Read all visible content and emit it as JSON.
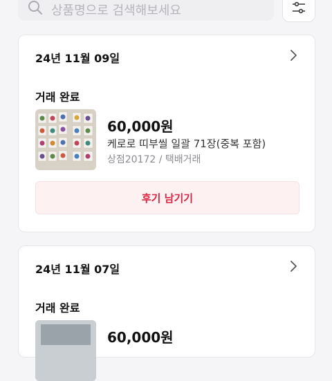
{
  "search": {
    "placeholder": "상품명으로 검색해보세요",
    "icon": "search-icon"
  },
  "filter": {
    "icon": "filter-sliders-icon"
  },
  "orders": [
    {
      "date": "24년 11월 09일",
      "status": "거래 완료",
      "price": "60,000원",
      "title": "케로로 띠부씰 일괄 71장(중복 포함)",
      "meta": "상점20172 / 택배거래",
      "review_label": "후기 남기기"
    },
    {
      "date": "24년 11월 07일",
      "status": "거래 완료",
      "price": "60,000원"
    }
  ],
  "colors": {
    "accent": "#d72640",
    "review_bg": "#fdf1f2",
    "page_bg": "#f5f5f7"
  }
}
